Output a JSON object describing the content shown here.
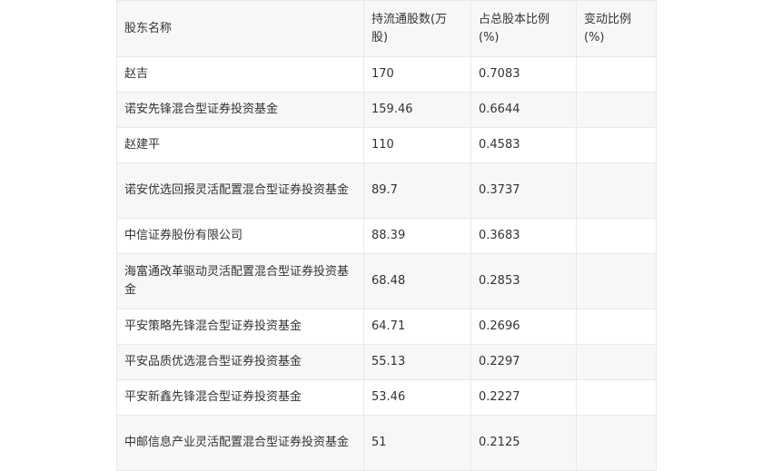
{
  "table": {
    "headers": [
      "股东名称",
      "持流通股数(万股)",
      "占总股本比例(%)",
      "变动比例(%)"
    ],
    "rows": [
      [
        "赵吉",
        "170",
        "0.7083",
        ""
      ],
      [
        "诺安先锋混合型证券投资基金",
        "159.46",
        "0.6644",
        ""
      ],
      [
        "赵建平",
        "110",
        "0.4583",
        ""
      ],
      [
        "诺安优选回报灵活配置混合型证券投资基金",
        "89.7",
        "0.3737",
        ""
      ],
      [
        "中信证券股份有限公司",
        "88.39",
        "0.3683",
        ""
      ],
      [
        "海富通改革驱动灵活配置混合型证券投资基金",
        "68.48",
        "0.2853",
        ""
      ],
      [
        "平安策略先锋混合型证券投资基金",
        "64.71",
        "0.2696",
        ""
      ],
      [
        "平安品质优选混合型证券投资基金",
        "55.13",
        "0.2297",
        ""
      ],
      [
        "平安新鑫先锋混合型证券投资基金",
        "53.46",
        "0.2227",
        ""
      ],
      [
        "中邮信息产业灵活配置混合型证券投资基金",
        "51",
        "0.2125",
        ""
      ]
    ]
  }
}
